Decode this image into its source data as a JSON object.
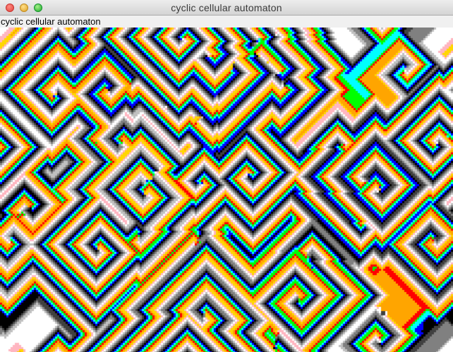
{
  "window": {
    "title": "cyclic cellular automaton"
  },
  "content": {
    "label": "cyclic cellular automaton"
  },
  "automaton": {
    "palette": [
      "#ff0000",
      "#ffa500",
      "#ffd700",
      "#ffb6c1",
      "#ffffff",
      "#c0c0c0",
      "#808080",
      "#404040",
      "#000000",
      "#0000ff",
      "#00ffff",
      "#00ff00"
    ],
    "states": 12
  },
  "controls": {
    "close_icon": "close-icon",
    "minimize_icon": "minimize-icon",
    "zoom_icon": "zoom-icon"
  }
}
